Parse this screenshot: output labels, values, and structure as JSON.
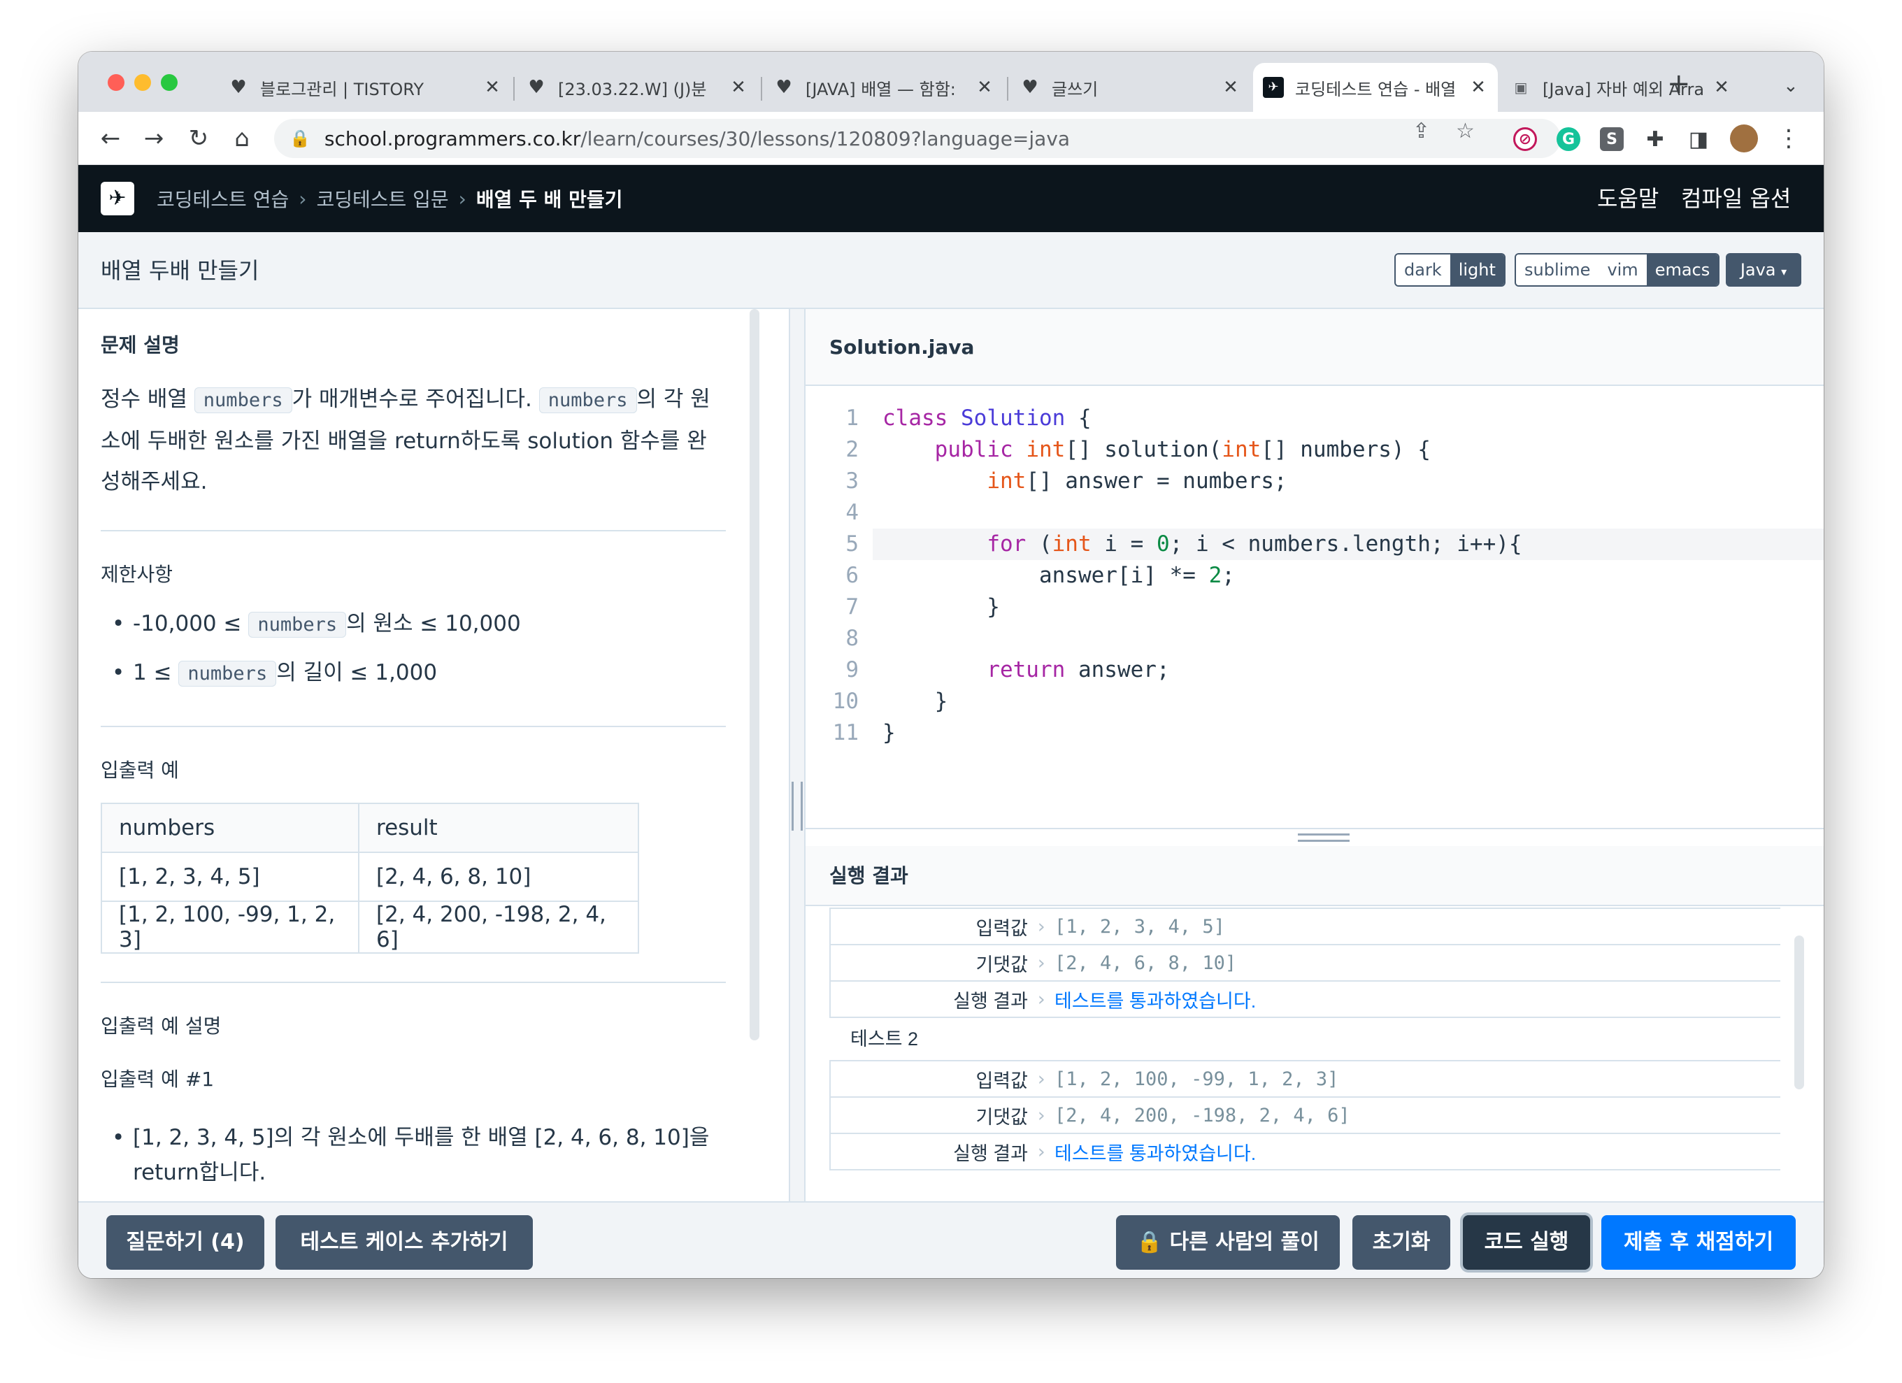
{
  "browser": {
    "tabs": [
      {
        "label": "블로그관리 | TISTORY",
        "icon": "yellow-heart-icon",
        "active": false
      },
      {
        "label": "[23.03.22.W] (J)분",
        "icon": "yellow-heart-icon",
        "active": false
      },
      {
        "label": "[JAVA] 배열 — 함함:",
        "icon": "yellow-heart-icon",
        "active": false
      },
      {
        "label": "글쓰기",
        "icon": "yellow-heart-icon",
        "active": false
      },
      {
        "label": "코딩테스트 연습 - 배열",
        "icon": "programmers-icon",
        "active": true
      },
      {
        "label": "[Java] 자바 예외 Arra",
        "icon": "page-icon",
        "active": false
      }
    ],
    "url_host": "school.programmers.co.kr",
    "url_path": "/learn/courses/30/lessons/120809?language=java"
  },
  "header": {
    "breadcrumbs": [
      "코딩테스트 연습",
      "코딩테스트 입문",
      "배열 두 배 만들기"
    ],
    "help_label": "도움말",
    "compile_options_label": "컴파일 옵션"
  },
  "challenge": {
    "title": "배열 두배 만들기",
    "theme_options": [
      "dark",
      "light"
    ],
    "theme_selected": "light",
    "keymap_options": [
      "sublime",
      "vim",
      "emacs"
    ],
    "keymap_selected": "emacs",
    "language": "Java"
  },
  "description": {
    "heading": "문제 설명",
    "line1_pre": "정수 배열 ",
    "code_numbers": "numbers",
    "line1_mid": "가 매개변수로 주어집니다. ",
    "line1_post": "의 각 원소에 두배한 원소를 가진 배열을 return하도록 solution 함수를 완성해주세요.",
    "constraints_heading": "제한사항",
    "constraint1_pre": "-10,000 ≤ ",
    "constraint1_post": "의 원소 ≤ 10,000",
    "constraint2_pre": "1 ≤ ",
    "constraint2_post": "의 길이 ≤ 1,000",
    "io_heading": "입출력 예",
    "io_table": {
      "headers": [
        "numbers",
        "result"
      ],
      "rows": [
        [
          "[1, 2, 3, 4, 5]",
          "[2, 4, 6, 8, 10]"
        ],
        [
          "[1, 2, 100, -99, 1, 2, 3]",
          "[2, 4, 200, -198, 2, 4, 6]"
        ]
      ]
    },
    "io_explain_heading": "입출력 예 설명",
    "io_example1_heading": "입출력 예 #1",
    "io_example1_bullet": "[1, 2, 3, 4, 5]의 각 원소에 두배를 한 배열 [2, 4, 6, 8, 10]을 return합니다."
  },
  "editor": {
    "filename": "Solution.java",
    "line_numbers": [
      "1",
      "2",
      "3",
      "4",
      "5",
      "6",
      "7",
      "8",
      "9",
      "10",
      "11"
    ],
    "highlighted_line": 5
  },
  "results": {
    "heading": "실행 결과",
    "rows": [
      {
        "label": "입력값",
        "value": "[1, 2, 3, 4, 5]"
      },
      {
        "label": "기댓값",
        "value": "[2, 4, 6, 8, 10]"
      },
      {
        "label": "실행 결과",
        "value": "테스트를 통과하였습니다."
      },
      {
        "group": "테스트 2"
      },
      {
        "label": "입력값",
        "value": "[1, 2, 100, -99, 1, 2, 3]"
      },
      {
        "label": "기댓값",
        "value": "[2, 4, 200, -198, 2, 4, 6]"
      },
      {
        "label": "실행 결과",
        "value": "테스트를 통과하였습니다."
      }
    ]
  },
  "actions": {
    "question": "질문하기 (4)",
    "add_testcase": "테스트 케이스 추가하기",
    "others_solutions": "다른 사람의 풀이",
    "reset": "초기화",
    "run": "코드 실행",
    "submit": "제출 후 채점하기"
  }
}
